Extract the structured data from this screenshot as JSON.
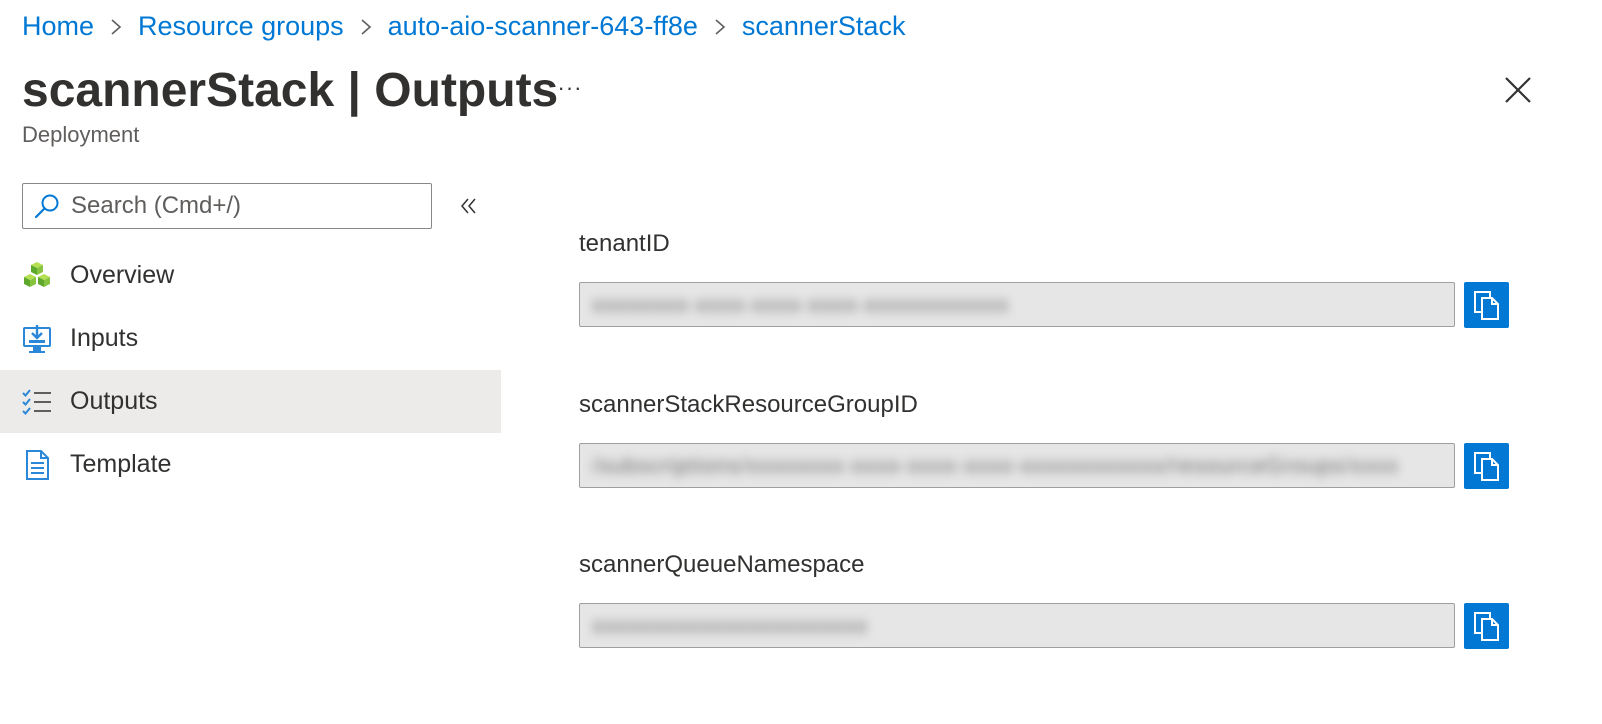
{
  "breadcrumb": [
    {
      "label": "Home"
    },
    {
      "label": "Resource groups"
    },
    {
      "label": "auto-aio-scanner-643-ff8e"
    },
    {
      "label": "scannerStack"
    }
  ],
  "header": {
    "title_bold": "scannerStack",
    "title_rest": " | Outputs",
    "more_label": "···",
    "subtitle": "Deployment"
  },
  "search": {
    "placeholder": "Search (Cmd+/)"
  },
  "nav": {
    "items": [
      {
        "label": "Overview",
        "icon": "cubes-icon"
      },
      {
        "label": "Inputs",
        "icon": "inputs-icon"
      },
      {
        "label": "Outputs",
        "icon": "checklist-icon",
        "active": true
      },
      {
        "label": "Template",
        "icon": "document-icon"
      }
    ]
  },
  "outputs": [
    {
      "name": "tenantID",
      "value": "xxxxxxxx-xxxx-xxxx-xxxx-xxxxxxxxxxxx"
    },
    {
      "name": "scannerStackResourceGroupID",
      "value": "/subscriptions/xxxxxxxx-xxxx-xxxx-xxxx-xxxxxxxxxxxx/resourceGroups/xxxx"
    },
    {
      "name": "scannerQueueNamespace",
      "value": "xxxxxxxxxxxxxxxxxxxxxxx"
    }
  ],
  "colors": {
    "accent": "#0078d4",
    "active_nav_bg": "#edebe9",
    "field_bg": "#e6e6e6"
  }
}
